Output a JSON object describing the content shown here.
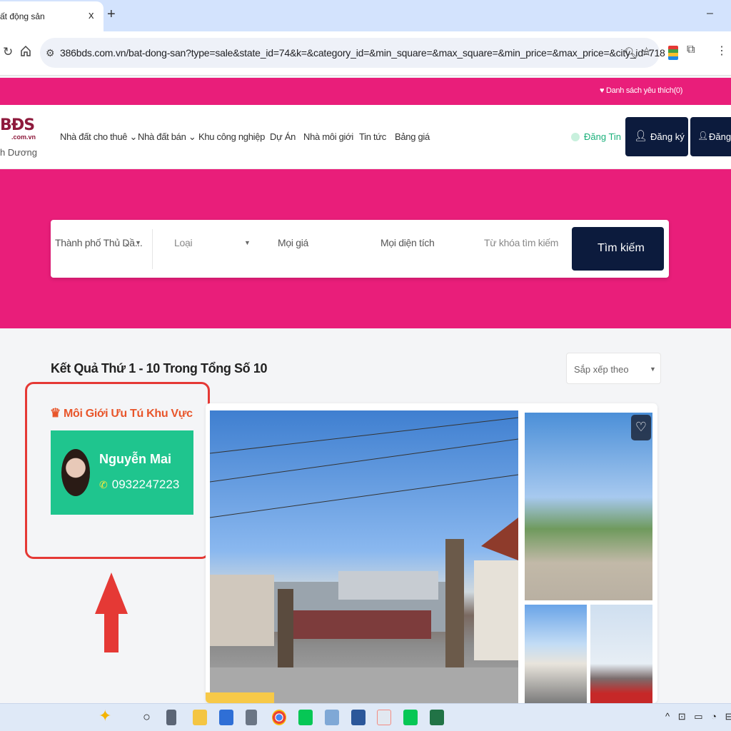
{
  "browser": {
    "tab_title": "ất động sản",
    "tab_close": "x",
    "new_tab": "+",
    "minimize": "–",
    "url": "386bds.com.vn/bat-dong-san?type=sale&state_id=74&k=&category_id=&min_square=&max_square=&min_price=&max_price=&city_id=718"
  },
  "topstrip": {
    "wishlist": "♥ Danh sách yêu thích(0)"
  },
  "header": {
    "logo": "BĐS",
    "logo_sub": ".com.vn",
    "logo_city": "h Dương",
    "menu": [
      {
        "label": "Nhà đất cho thuê ⌄"
      },
      {
        "label": "Nhà đất bán ⌄"
      },
      {
        "label": "Khu công nghiệp"
      },
      {
        "label": "Dự Án"
      },
      {
        "label": "Nhà môi giới"
      },
      {
        "label": "Tin tức"
      },
      {
        "label": "Bảng giá"
      }
    ],
    "post_label": "Đăng Tin",
    "register_label": "Đăng ký",
    "login_label": "Đăng"
  },
  "search": {
    "city": "Thành phố Thủ Dầ...",
    "city_clear": "×",
    "type": "Loại",
    "price": "Mọi giá",
    "area": "Mọi diện tích",
    "keyword_placeholder": "Từ khóa tìm kiếm",
    "button": "Tìm kiếm"
  },
  "results": {
    "title": "Kết Quả Thứ 1 - 10 Trong Tổng Số 10",
    "sort_placeholder": "Sắp xếp theo"
  },
  "broker": {
    "section_title": "Môi Giới Ưu Tú Khu Vực",
    "name": "Nguyễn Mai",
    "phone": "0932247223"
  },
  "colors": {
    "brand_pink": "#e91e7a",
    "navy": "#0c1b3d",
    "broker_green": "#1fc58e",
    "highlight_red": "#e53935"
  },
  "taskbar": {
    "tray": "^ ⊡ ▭ ◔ ⊟"
  }
}
